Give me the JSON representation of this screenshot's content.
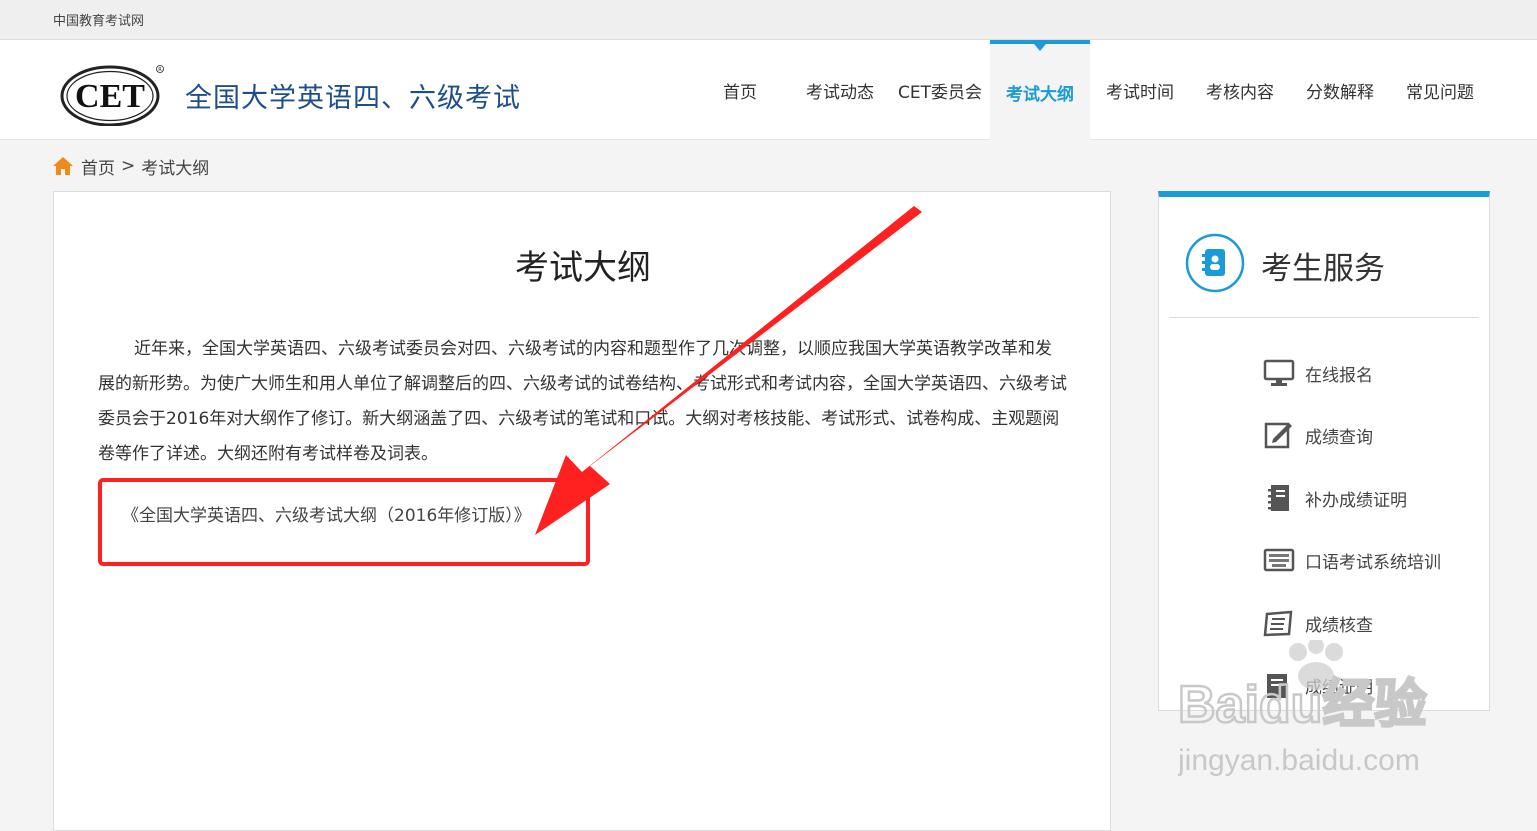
{
  "topbar": {
    "site_name": "中国教育考试网"
  },
  "header": {
    "logo_text": "CET",
    "site_title": "全国大学英语四、六级考试",
    "nav": [
      {
        "label": "首页"
      },
      {
        "label": "考试动态"
      },
      {
        "label": "CET委员会"
      },
      {
        "label": "考试大纲",
        "active": true
      },
      {
        "label": "考试时间"
      },
      {
        "label": "考核内容"
      },
      {
        "label": "分数解释"
      },
      {
        "label": "常见问题"
      }
    ]
  },
  "breadcrumb": {
    "home": "首页",
    "separator": ">",
    "current": "考试大纲"
  },
  "article": {
    "title": "考试大纲",
    "paragraph": "近年来，全国大学英语四、六级考试委员会对四、六级考试的内容和题型作了几次调整，以顺应我国大学英语教学改革和发展的新形势。为使广大师生和用人单位了解调整后的四、六级考试的试卷结构、考试形式和考试内容，全国大学英语四、六级考试委员会于2016年对大纲作了修订。新大纲涵盖了四、六级考试的笔试和口试。大纲对考核技能、考试形式、试卷构成、主观题阅卷等作了详述。大纲还附有考试样卷及词表。",
    "document_link": "《全国大学英语四、六级考试大纲（2016年修订版）》"
  },
  "sidebar": {
    "title": "考生服务",
    "services": [
      {
        "label": "在线报名",
        "icon": "monitor-icon"
      },
      {
        "label": "成绩查询",
        "icon": "edit-icon"
      },
      {
        "label": "补办成绩证明",
        "icon": "notebook-icon"
      },
      {
        "label": "口语考试系统培训",
        "icon": "keyboard-icon"
      },
      {
        "label": "成绩核查",
        "icon": "book-icon"
      },
      {
        "label": "成绩证明",
        "icon": "certificate-icon"
      }
    ]
  },
  "annotation": {
    "highlight_color": "#ff2020"
  },
  "watermark": {
    "brand": "Baidu经验",
    "url": "jingyan.baidu.com"
  },
  "colors": {
    "accent": "#1a9ad6",
    "title_blue": "#1f4e8c",
    "home_icon": "#f08a1c"
  }
}
